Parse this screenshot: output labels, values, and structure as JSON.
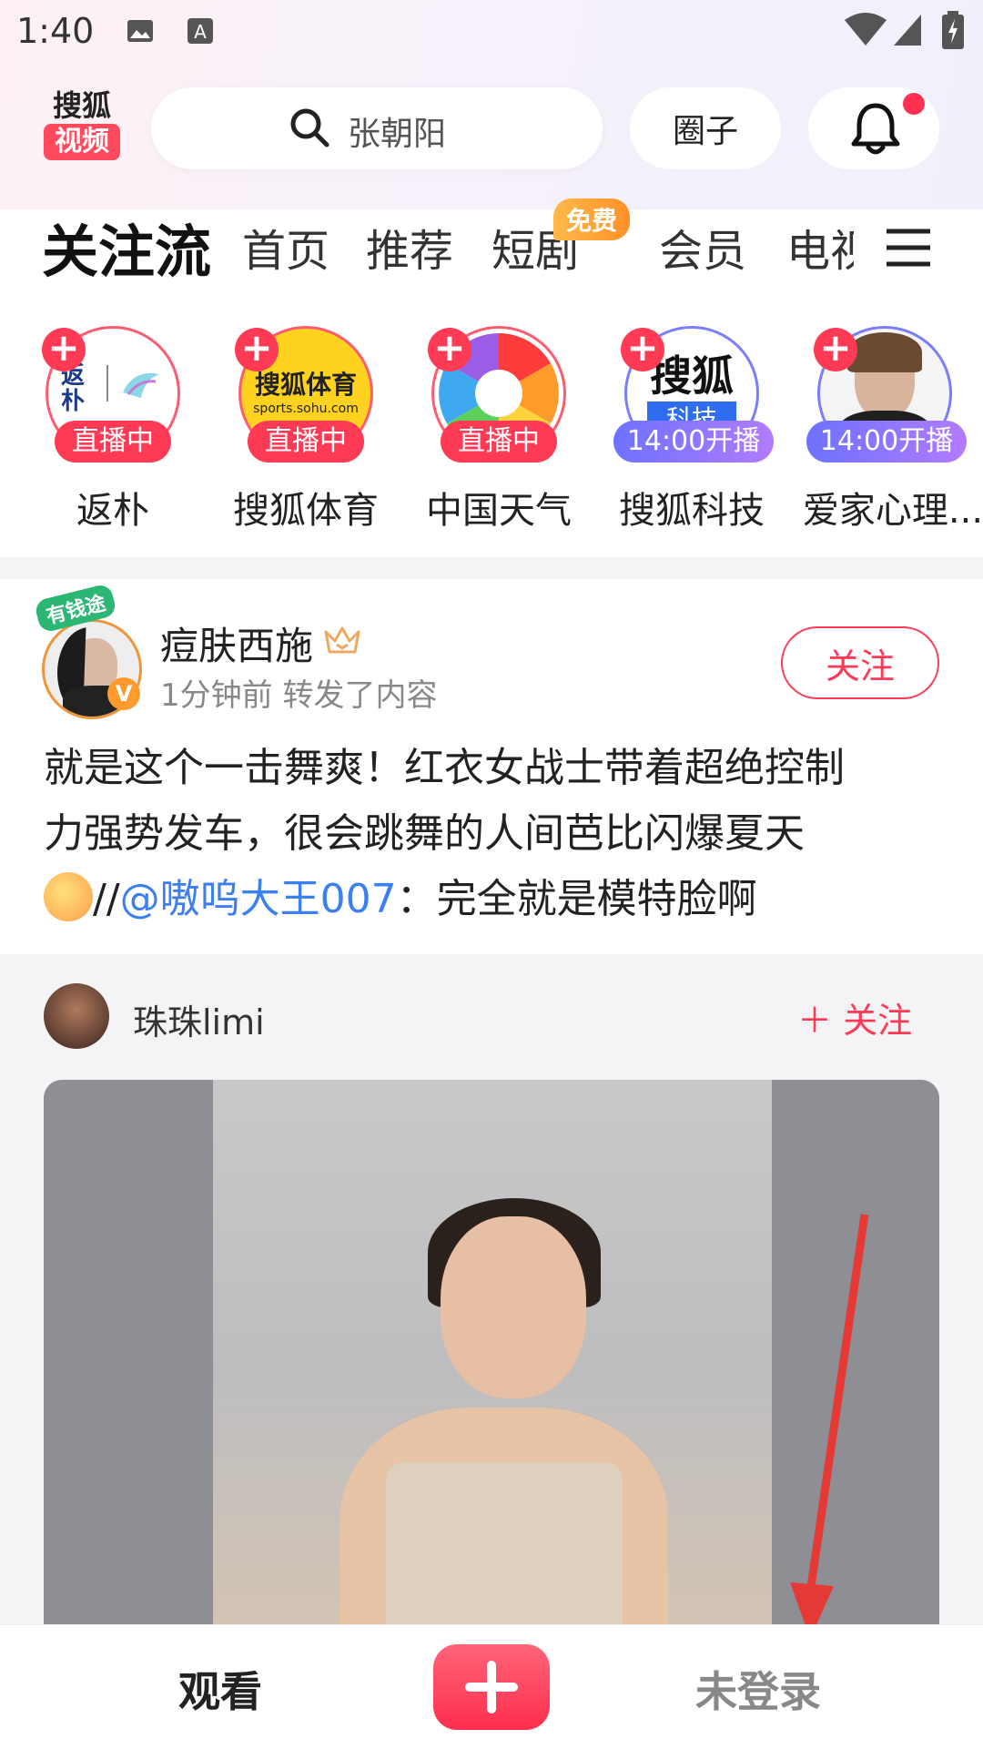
{
  "status_bar": {
    "time": "1:40"
  },
  "header": {
    "logo_line1": "搜狐",
    "logo_line2": "视频",
    "search_placeholder": "张朝阳",
    "circle_label": "圈子"
  },
  "tabs": [
    {
      "label": "关注流"
    },
    {
      "label": "首页"
    },
    {
      "label": "推荐"
    },
    {
      "label": "短剧"
    },
    {
      "label": "会员"
    },
    {
      "label": "电视"
    }
  ],
  "free_badge": "免费",
  "following": [
    {
      "name": "返朴",
      "status": "直播中",
      "avatar_text": "返朴"
    },
    {
      "name": "搜狐体育",
      "status": "直播中",
      "avatar_text": "搜狐体育",
      "avatar_sub": "sports.sohu.com"
    },
    {
      "name": "中国天气",
      "status": "直播中"
    },
    {
      "name": "搜狐科技",
      "status": "14:00开播",
      "avatar_text": "搜狐",
      "avatar_sub": "科技"
    },
    {
      "name": "爱家心理...",
      "status": "14:00开播"
    }
  ],
  "post": {
    "badge": "有钱途",
    "author": "痘肤西施",
    "meta": "1分钟前 转发了内容",
    "follow": "关注",
    "text_line1": "就是这个一击舞爽！红衣女战士带着超绝控制",
    "text_line2": "力强势发车，很会跳舞的人间芭比闪爆夏天",
    "text_prefix": "//",
    "mention": "@嗷呜大王007",
    "text_tail": "：完全就是模特脸啊"
  },
  "repost": {
    "author": "珠珠limi",
    "follow": "关注"
  },
  "bottom_nav": {
    "watch": "观看",
    "login": "未登录"
  },
  "colors": {
    "accent": "#ff3a55",
    "link": "#3b7ff2",
    "live_blue": "#6d72ff"
  }
}
